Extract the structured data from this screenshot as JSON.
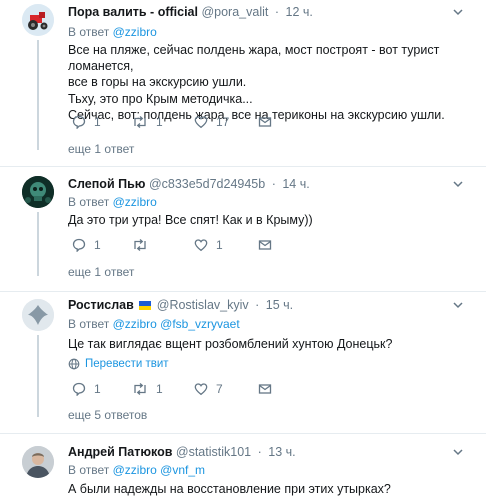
{
  "tweets": [
    {
      "name": "Пора валить - official",
      "handle": "@pora_valit",
      "time": "12 ч.",
      "reply_label": "В ответ",
      "reply_mentions": "@zzibro",
      "lines": [
        "Все на пляже, сейчас полдень жара, мост построят - вот турист ломанется,",
        "все в горы на экскурсию ушли.",
        "Тьху, это про Крым методичка...",
        "Сейчас, вот: полдень жара, все на териконы на экскурсию ушли."
      ],
      "reply_count": "1",
      "retweet_count": "1",
      "like_count": "17",
      "more": "еще 1 ответ"
    },
    {
      "name": "Слепой Пью",
      "handle": "@c833e5d7d24945b",
      "time": "14 ч.",
      "reply_label": "В ответ",
      "reply_mentions": "@zzibro",
      "lines": [
        "Да это три утра! Все спят! Как и в Крыму))"
      ],
      "reply_count": "1",
      "retweet_count": "",
      "like_count": "1",
      "more": "еще 1 ответ"
    },
    {
      "name": "Ростислав",
      "handle": "@Rostislav_kyiv",
      "time": "15 ч.",
      "reply_label": "В ответ",
      "reply_mentions": "@zzibro @fsb_vzryvaet",
      "lines": [
        "Це так виглядає вщент розбомблений хунтою Донецьк?"
      ],
      "translate": "Перевести твит",
      "reply_count": "1",
      "retweet_count": "1",
      "like_count": "7",
      "more": "еще 5 ответов"
    },
    {
      "name": "Андрей Патюков",
      "handle": "@statistik101",
      "time": "13 ч.",
      "reply_label": "В ответ",
      "reply_mentions": "@zzibro @vnf_m",
      "lines": [
        "А были надежды на восстановление при этих утырках?"
      ]
    }
  ],
  "colors": {
    "text": "#14171a",
    "secondary": "#657786",
    "link": "#1b95e0",
    "divider": "#e6ecf0"
  }
}
